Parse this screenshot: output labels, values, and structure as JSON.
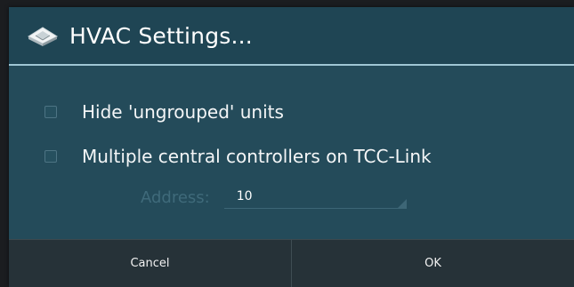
{
  "dialog": {
    "title": "HVAC Settings...",
    "title_icon": "hvac-cassette-unit-icon"
  },
  "options": [
    {
      "label": "Hide 'ungrouped' units",
      "checked": false
    },
    {
      "label": "Multiple central controllers on TCC-Link",
      "checked": false
    }
  ],
  "address": {
    "label": "Address:",
    "value": "10",
    "enabled": false
  },
  "buttons": {
    "cancel": "Cancel",
    "ok": "OK"
  },
  "colors": {
    "dialog_background": "#244b5a",
    "title_divider": "#9fc6d4",
    "button_bar": "#263238"
  }
}
